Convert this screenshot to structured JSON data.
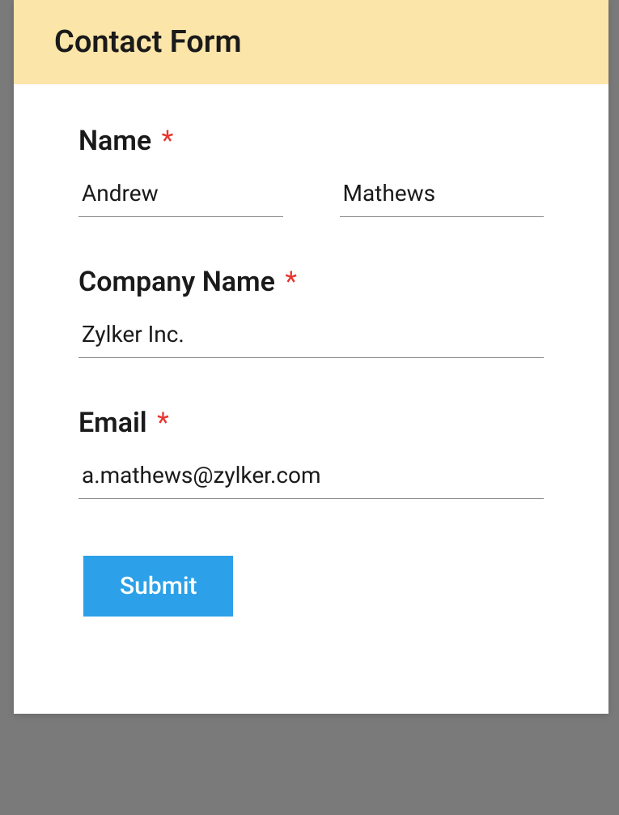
{
  "form": {
    "title": "Contact Form",
    "fields": {
      "name": {
        "label": "Name",
        "required": true,
        "first_value": "Andrew",
        "last_value": "Mathews"
      },
      "company": {
        "label": "Company Name",
        "required": true,
        "value": "Zylker Inc."
      },
      "email": {
        "label": "Email",
        "required": true,
        "value": "a.mathews@zylker.com"
      }
    },
    "submit_label": "Submit"
  },
  "required_marker": "*"
}
